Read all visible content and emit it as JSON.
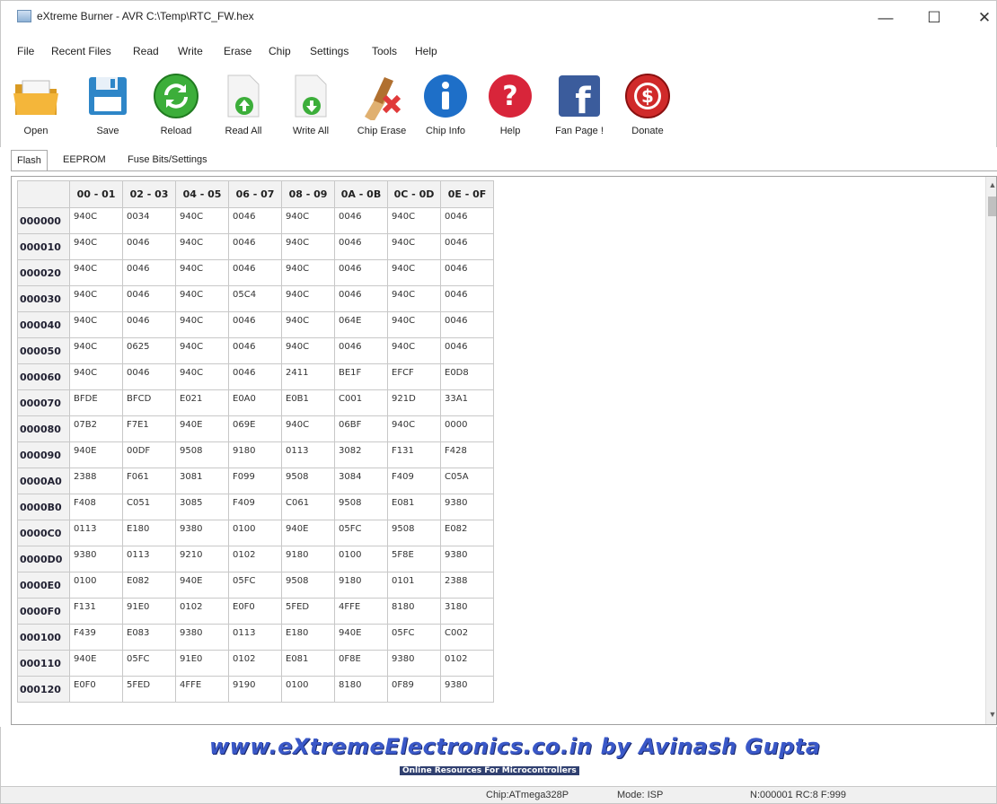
{
  "window": {
    "title": "eXtreme Burner - AVR C:\\Temp\\RTC_FW.hex",
    "minimize": "—",
    "maximize": "☐",
    "close": "✕"
  },
  "menu": [
    "File",
    "Recent Files",
    "Read",
    "Write",
    "Erase",
    "Chip",
    "Settings",
    "Tools",
    "Help"
  ],
  "toolbar": [
    {
      "label": "Open",
      "icon": "folder-open-icon"
    },
    {
      "label": "Save",
      "icon": "floppy-disk-icon"
    },
    {
      "label": "Reload",
      "icon": "refresh-icon"
    },
    {
      "label": "Read All",
      "icon": "read-all-icon"
    },
    {
      "label": "Write All",
      "icon": "write-all-icon"
    },
    {
      "label": "Chip Erase",
      "icon": "chip-erase-icon"
    },
    {
      "label": "Chip Info",
      "icon": "info-icon"
    },
    {
      "label": "Help",
      "icon": "help-icon",
      "glyph": "?"
    },
    {
      "label": "Fan Page !",
      "icon": "facebook-icon",
      "glyph": "f"
    },
    {
      "label": "Donate",
      "icon": "donate-icon",
      "glyph": "$"
    }
  ],
  "tabs": [
    "Flash",
    "EEPROM",
    "Fuse Bits/Settings"
  ],
  "grid": {
    "columns": [
      "00 - 01",
      "02 - 03",
      "04 - 05",
      "06 - 07",
      "08 - 09",
      "0A - 0B",
      "0C - 0D",
      "0E - 0F"
    ],
    "rows": [
      {
        "addr": "000000",
        "cells": [
          "940C",
          "0034",
          "940C",
          "0046",
          "940C",
          "0046",
          "940C",
          "0046"
        ]
      },
      {
        "addr": "000010",
        "cells": [
          "940C",
          "0046",
          "940C",
          "0046",
          "940C",
          "0046",
          "940C",
          "0046"
        ]
      },
      {
        "addr": "000020",
        "cells": [
          "940C",
          "0046",
          "940C",
          "0046",
          "940C",
          "0046",
          "940C",
          "0046"
        ]
      },
      {
        "addr": "000030",
        "cells": [
          "940C",
          "0046",
          "940C",
          "05C4",
          "940C",
          "0046",
          "940C",
          "0046"
        ]
      },
      {
        "addr": "000040",
        "cells": [
          "940C",
          "0046",
          "940C",
          "0046",
          "940C",
          "064E",
          "940C",
          "0046"
        ]
      },
      {
        "addr": "000050",
        "cells": [
          "940C",
          "0625",
          "940C",
          "0046",
          "940C",
          "0046",
          "940C",
          "0046"
        ]
      },
      {
        "addr": "000060",
        "cells": [
          "940C",
          "0046",
          "940C",
          "0046",
          "2411",
          "BE1F",
          "EFCF",
          "E0D8"
        ]
      },
      {
        "addr": "000070",
        "cells": [
          "BFDE",
          "BFCD",
          "E021",
          "E0A0",
          "E0B1",
          "C001",
          "921D",
          "33A1"
        ]
      },
      {
        "addr": "000080",
        "cells": [
          "07B2",
          "F7E1",
          "940E",
          "069E",
          "940C",
          "06BF",
          "940C",
          "0000"
        ]
      },
      {
        "addr": "000090",
        "cells": [
          "940E",
          "00DF",
          "9508",
          "9180",
          "0113",
          "3082",
          "F131",
          "F428"
        ]
      },
      {
        "addr": "0000A0",
        "cells": [
          "2388",
          "F061",
          "3081",
          "F099",
          "9508",
          "3084",
          "F409",
          "C05A"
        ]
      },
      {
        "addr": "0000B0",
        "cells": [
          "F408",
          "C051",
          "3085",
          "F409",
          "C061",
          "9508",
          "E081",
          "9380"
        ]
      },
      {
        "addr": "0000C0",
        "cells": [
          "0113",
          "E180",
          "9380",
          "0100",
          "940E",
          "05FC",
          "9508",
          "E082"
        ]
      },
      {
        "addr": "0000D0",
        "cells": [
          "9380",
          "0113",
          "9210",
          "0102",
          "9180",
          "0100",
          "5F8E",
          "9380"
        ]
      },
      {
        "addr": "0000E0",
        "cells": [
          "0100",
          "E082",
          "940E",
          "05FC",
          "9508",
          "9180",
          "0101",
          "2388"
        ]
      },
      {
        "addr": "0000F0",
        "cells": [
          "F131",
          "91E0",
          "0102",
          "E0F0",
          "5FED",
          "4FFE",
          "8180",
          "3180"
        ]
      },
      {
        "addr": "000100",
        "cells": [
          "F439",
          "E083",
          "9380",
          "0113",
          "E180",
          "940E",
          "05FC",
          "C002"
        ]
      },
      {
        "addr": "000110",
        "cells": [
          "940E",
          "05FC",
          "91E0",
          "0102",
          "E081",
          "0F8E",
          "9380",
          "0102"
        ]
      },
      {
        "addr": "000120",
        "cells": [
          "E0F0",
          "5FED",
          "4FFE",
          "9190",
          "0100",
          "8180",
          "0F89",
          "9380"
        ]
      }
    ]
  },
  "scrollbar": {
    "up": "▲",
    "down": "▼"
  },
  "banner": {
    "main": "www.eXtremeElectronics.co.in by Avinash Gupta",
    "sub": "Online Resources For Microcontrollers"
  },
  "status": {
    "chip": "Chip:ATmega328P",
    "mode": "Mode: ISP",
    "counters": "N:000001 RC:8 F:999"
  },
  "colors": {
    "reload": "#3cae3a",
    "info": "#1e6fc8",
    "help": "#d8253a",
    "facebook": "#3b5c9c",
    "donate": "#d02a2a",
    "folder": "#f4b63a",
    "floppy": "#2e86c8"
  }
}
